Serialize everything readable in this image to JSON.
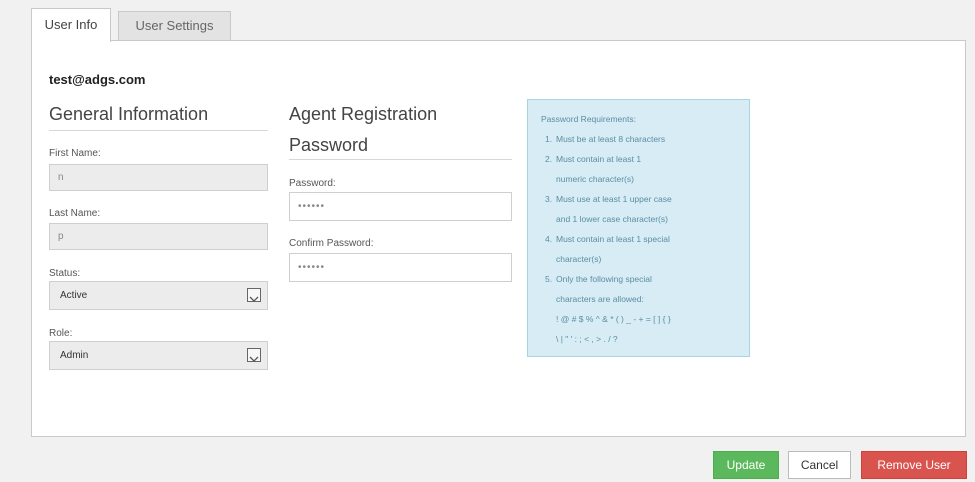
{
  "tabs": [
    {
      "label": "User Info",
      "active": true
    },
    {
      "label": "User Settings",
      "active": false
    }
  ],
  "user_email": "test@adgs.com",
  "general": {
    "title": "General Information",
    "first_name_label": "First Name:",
    "first_name_value": "n",
    "last_name_label": "Last Name:",
    "last_name_value": "p",
    "status_label": "Status:",
    "status_value": "Active",
    "role_label": "Role:",
    "role_value": "Admin"
  },
  "agent": {
    "title_line1": "Agent Registration",
    "title_line2": "Password",
    "password_label": "Password:",
    "password_value": "••••••",
    "confirm_label": "Confirm Password:",
    "confirm_value": "••••••"
  },
  "requirements": {
    "title": "Password Requirements:",
    "items": [
      {
        "num": "1.",
        "lines": [
          "Must be at least 8 characters"
        ]
      },
      {
        "num": "2.",
        "lines": [
          "Must contain at least 1",
          "numeric character(s)"
        ]
      },
      {
        "num": "3.",
        "lines": [
          "Must use at least 1 upper case",
          "and 1 lower case character(s)"
        ]
      },
      {
        "num": "4.",
        "lines": [
          "Must contain at least 1 special",
          "character(s)"
        ]
      },
      {
        "num": "5.",
        "lines": [
          "Only the following special",
          "characters are allowed:",
          "! @ # $ % ^ & * ( ) _ - + = [ ] { }",
          "\\ | \" ' : ; < , > . / ?"
        ]
      }
    ]
  },
  "buttons": {
    "update": "Update",
    "cancel": "Cancel",
    "remove": "Remove User"
  },
  "colors": {
    "update": "#5cb85c",
    "remove": "#d9534f",
    "requirements_bg": "#d7ecf4"
  }
}
